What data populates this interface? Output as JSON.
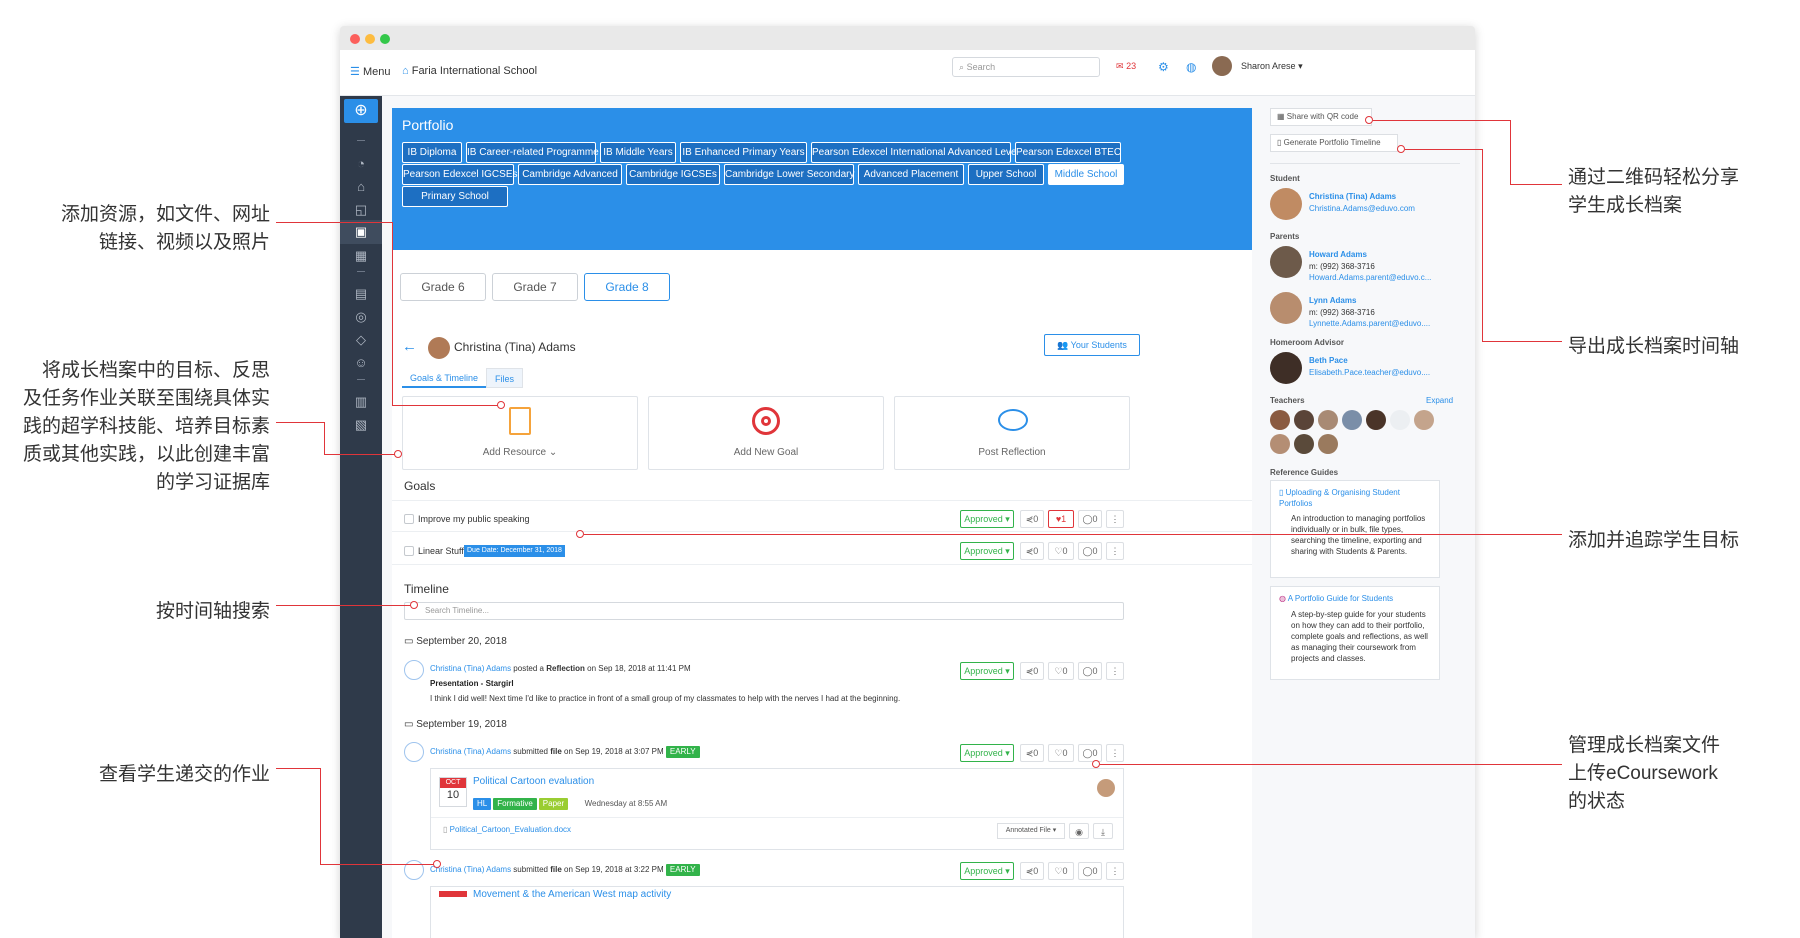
{
  "topbar": {
    "menu_label": "Menu",
    "school_name": "Faria International School",
    "search_placeholder": "Search",
    "mail_count": "23",
    "user_name": "Sharon Arese"
  },
  "portfolio": {
    "title": "Portfolio",
    "programmes": [
      "IB Diploma",
      "IB Career-related Programme",
      "IB Middle Years",
      "IB Enhanced Primary Years",
      "Pearson Edexcel International Advanced Levels",
      "Pearson Edexcel BTEC",
      "Pearson Edexcel IGCSEs",
      "Cambridge Advanced",
      "Cambridge IGCSEs",
      "Cambridge Lower Secondary",
      "Advanced Placement",
      "Upper School",
      "Middle School",
      "Primary School"
    ],
    "active_programme": "Middle School",
    "grades": [
      "Grade 6",
      "Grade 7",
      "Grade 8"
    ],
    "active_grade": "Grade 8",
    "student_name": "Christina (Tina) Adams",
    "your_students": "Your Students",
    "tabs": [
      "Goals & Timeline",
      "Files"
    ],
    "actions": {
      "add_resource": "Add Resource",
      "add_goal": "Add New Goal",
      "post_reflection": "Post Reflection"
    }
  },
  "goals": {
    "heading": "Goals",
    "items": [
      {
        "label": "Improve my public speaking",
        "status": "Approved",
        "shares": "0",
        "likes": "1",
        "comments": "0"
      },
      {
        "label": "Linear Stuff",
        "due": "Due Date: December 31, 2018",
        "status": "Approved",
        "shares": "0",
        "likes": "0",
        "comments": "0"
      }
    ]
  },
  "timeline": {
    "heading": "Timeline",
    "search_placeholder": "Search Timeline...",
    "dates": [
      "September 20, 2018",
      "September 19, 2018"
    ],
    "entry1": {
      "author": "Christina (Tina) Adams",
      "verb": "posted a",
      "type": "Reflection",
      "when": "on Sep 18, 2018 at 11:41 PM",
      "title": "Presentation - Stargirl",
      "body": "I think I did well! Next time I'd like to practice in front of a small group of my classmates to help with the nerves I had at the beginning.",
      "status": "Approved",
      "shares": "0",
      "likes": "0",
      "comments": "0"
    },
    "entry2": {
      "author": "Christina (Tina) Adams",
      "verb": "submitted",
      "type": "file",
      "when": "on Sep 19, 2018 at 3:07 PM",
      "badge": "EARLY",
      "status": "Approved",
      "shares": "0",
      "likes": "0",
      "comments": "0",
      "task": {
        "month": "OCT",
        "day": "10",
        "title": "Political Cartoon evaluation",
        "tags": [
          "HL",
          "Formative",
          "Paper"
        ],
        "due": "Wednesday at 8:55 AM"
      },
      "file": "Political_Cartoon_Evaluation.docx",
      "annotated": "Annotated File"
    },
    "entry3": {
      "author": "Christina (Tina) Adams",
      "verb": "submitted",
      "type": "file",
      "when": "on Sep 19, 2018 at 3:22 PM",
      "badge": "EARLY",
      "status": "Approved",
      "shares": "0",
      "likes": "0",
      "comments": "0",
      "task_title": "Movement & the American West map activity"
    }
  },
  "right": {
    "share_qr": "Share with QR code",
    "generate_timeline": "Generate Portfolio Timeline",
    "student_heading": "Student",
    "student": {
      "name": "Christina (Tina) Adams",
      "email": "Christina.Adams@eduvo.com"
    },
    "parents_heading": "Parents",
    "parents": [
      {
        "name": "Howard Adams",
        "phone": "m: (992) 368-3716",
        "email": "Howard.Adams.parent@eduvo.c..."
      },
      {
        "name": "Lynn Adams",
        "phone": "m: (992) 368-3716",
        "email": "Lynnette.Adams.parent@eduvo...."
      }
    ],
    "advisor_heading": "Homeroom Advisor",
    "advisor": {
      "name": "Beth Pace",
      "email": "Elisabeth.Pace.teacher@eduvo...."
    },
    "teachers_heading": "Teachers",
    "expand": "Expand",
    "guides_heading": "Reference Guides",
    "guides": [
      {
        "title": "Uploading & Organising Student Portfolios",
        "body": "An introduction to managing portfolios individually or in bulk, file types, searching the timeline, exporting and sharing with Students & Parents."
      },
      {
        "title": "A Portfolio Guide for Students",
        "body": "A step-by-step guide for your students on how they can add to their portfolio, complete goals and reflections, as well as managing their coursework from projects and classes."
      }
    ]
  },
  "annotations": {
    "add_resource": [
      "添加资源，如文件、网址",
      "链接、视频以及照片"
    ],
    "link_goals": [
      "将成长档案中的目标、反思",
      "及任务作业关联至围绕具体实",
      "践的超学科技能、培养目标素",
      "质或其他实践，以此创建丰富",
      "的学习证据库"
    ],
    "search_timeline": "按时间轴搜索",
    "view_work": "查看学生递交的作业",
    "share_qr": [
      "通过二维码轻松分享",
      "学生成长档案"
    ],
    "export_timeline": "导出成长档案时间轴",
    "track_goals": "添加并追踪学生目标",
    "manage_files": [
      "管理成长档案文件",
      "上传eCoursework",
      "的状态"
    ]
  },
  "colors": {
    "accent": "#2b8fe8",
    "sidebar": "#2f3a4a",
    "approved": "#32b34a",
    "annotation": "#e0353a"
  }
}
